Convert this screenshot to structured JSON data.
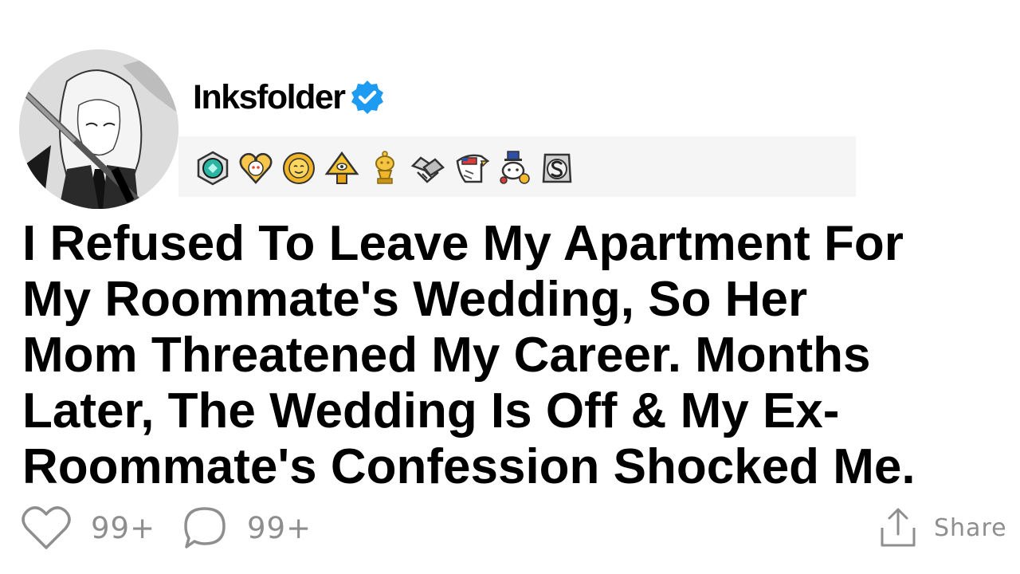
{
  "post": {
    "author": {
      "name": "Inksfolder",
      "verified": true,
      "avatar_icon": "anime-girl-with-sword-avatar"
    },
    "awards": [
      {
        "icon": "teal-gem-award-icon"
      },
      {
        "icon": "wholesome-heart-award-icon"
      },
      {
        "icon": "sun-face-award-icon"
      },
      {
        "icon": "pyramid-eye-award-icon"
      },
      {
        "icon": "gold-trophy-snoo-award-icon"
      },
      {
        "icon": "handshake-award-icon"
      },
      {
        "icon": "eagle-flag-award-icon"
      },
      {
        "icon": "snoo-uncle-sam-award-icon"
      },
      {
        "icon": "silver-s-award-icon"
      }
    ],
    "title_lines": [
      "I Refused To Leave My Apartment For",
      "My Roommate's Wedding, So Her",
      "Mom Threatened My Career. Months",
      "Later, The Wedding Is Off & My Ex-",
      "Roommate's Confession Shocked Me."
    ],
    "likes": "99+",
    "comments": "99+",
    "share_label": "Share"
  },
  "colors": {
    "verified_badge": "#1d9bf0",
    "awards_background": "#f5f5f5",
    "muted_text": "#8e8e8e"
  }
}
